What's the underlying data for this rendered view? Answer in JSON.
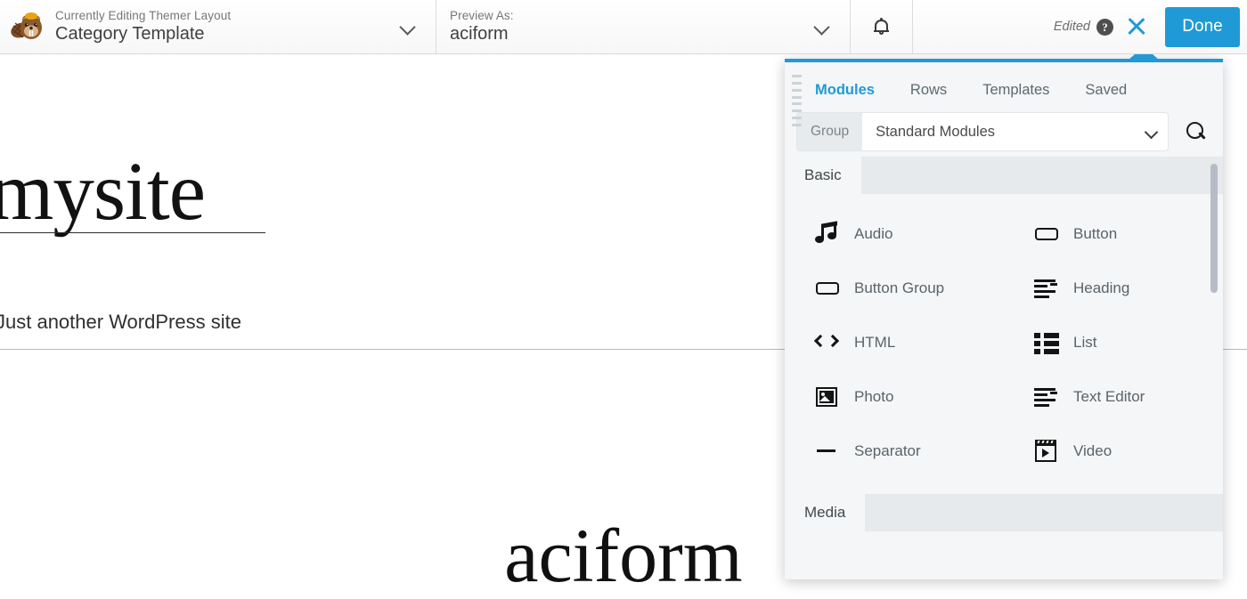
{
  "topbar": {
    "logo_icon": "beaver-logo-icon",
    "layout": {
      "eyebrow": "Currently Editing Themer Layout",
      "title": "Category Template",
      "chevron_icon": "chevron-down-icon"
    },
    "preview": {
      "eyebrow": "Preview As:",
      "value": "aciform",
      "chevron_icon": "chevron-down-icon"
    },
    "notifications_icon": "bell-icon",
    "status_label": "Edited",
    "help_badge": "?",
    "close_icon": "close-x-icon",
    "done_label": "Done",
    "accent_color": "#1f9ad6"
  },
  "page": {
    "site_title": "mysite",
    "tagline": "Just another WordPress site",
    "archive_title": "aciform"
  },
  "panel": {
    "drag_handle_icon": "drag-handle-icon",
    "tabs": [
      {
        "label": "Modules",
        "active": true
      },
      {
        "label": "Rows",
        "active": false
      },
      {
        "label": "Templates",
        "active": false
      },
      {
        "label": "Saved",
        "active": false
      }
    ],
    "group_select": {
      "badge_label": "Group",
      "value": "Standard Modules",
      "chevron_icon": "chevron-down-icon"
    },
    "search_icon": "search-icon",
    "sections": [
      {
        "name": "Basic",
        "modules": [
          {
            "label": "Audio",
            "icon": "audio-icon"
          },
          {
            "label": "Button",
            "icon": "button-icon"
          },
          {
            "label": "Button Group",
            "icon": "button-group-icon"
          },
          {
            "label": "Heading",
            "icon": "heading-icon"
          },
          {
            "label": "HTML",
            "icon": "html-icon"
          },
          {
            "label": "List",
            "icon": "list-icon"
          },
          {
            "label": "Photo",
            "icon": "photo-icon"
          },
          {
            "label": "Text Editor",
            "icon": "text-editor-icon"
          },
          {
            "label": "Separator",
            "icon": "separator-icon"
          },
          {
            "label": "Video",
            "icon": "video-icon"
          }
        ]
      },
      {
        "name": "Media",
        "modules": []
      }
    ]
  }
}
